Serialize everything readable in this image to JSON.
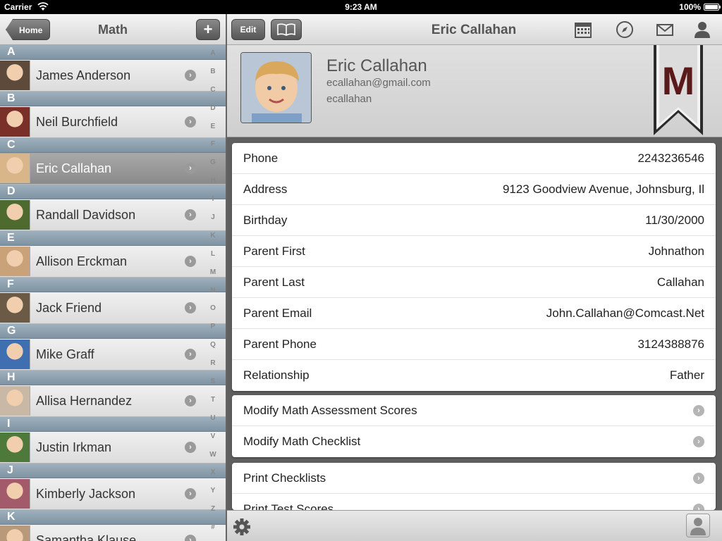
{
  "status_bar": {
    "carrier": "Carrier",
    "time": "9:23 AM",
    "battery": "100%"
  },
  "left": {
    "home_label": "Home",
    "title": "Math",
    "add_label": "+",
    "sections": [
      {
        "letter": "A",
        "name": "James Anderson",
        "color": "#5d4a3a",
        "selected": false
      },
      {
        "letter": "B",
        "name": "Neil Burchfield",
        "color": "#7a3028",
        "selected": false
      },
      {
        "letter": "C",
        "name": "Eric Callahan",
        "color": "#d9b68a",
        "selected": true
      },
      {
        "letter": "D",
        "name": "Randall Davidson",
        "color": "#4e6a2e",
        "selected": false
      },
      {
        "letter": "E",
        "name": "Allison Erckman",
        "color": "#c9a27a",
        "selected": false
      },
      {
        "letter": "F",
        "name": "Jack Friend",
        "color": "#6b5a45",
        "selected": false
      },
      {
        "letter": "G",
        "name": "Mike Graff",
        "color": "#3f6fb0",
        "selected": false
      },
      {
        "letter": "H",
        "name": "Allisa Hernandez",
        "color": "#c8b8a5",
        "selected": false
      },
      {
        "letter": "I",
        "name": "Justin Irkman",
        "color": "#4d7a3a",
        "selected": false
      },
      {
        "letter": "J",
        "name": "Kimberly Jackson",
        "color": "#a35a6a",
        "selected": false
      },
      {
        "letter": "K",
        "name": "Samantha Klause",
        "color": "#b89a7a",
        "selected": false
      }
    ],
    "index_letters": [
      "A",
      "B",
      "C",
      "D",
      "E",
      "F",
      "G",
      "H",
      "I",
      "J",
      "K",
      "L",
      "M",
      "N",
      "O",
      "P",
      "Q",
      "R",
      "S",
      "T",
      "U",
      "V",
      "W",
      "X",
      "Y",
      "Z",
      "#"
    ]
  },
  "right": {
    "edit_label": "Edit",
    "title": "Eric Callahan",
    "profile": {
      "name": "Eric Callahan",
      "email": "ecallahan@gmail.com",
      "username": "ecallahan",
      "ribbon_letter": "M"
    },
    "details": [
      {
        "label": "Phone",
        "value": "2243236546"
      },
      {
        "label": "Address",
        "value": "9123 Goodview Avenue, Johnsburg, Il"
      },
      {
        "label": "Birthday",
        "value": "11/30/2000"
      },
      {
        "label": "Parent First",
        "value": "Johnathon"
      },
      {
        "label": "Parent Last",
        "value": "Callahan"
      },
      {
        "label": "Parent Email",
        "value": "John.Callahan@Comcast.Net"
      },
      {
        "label": "Parent Phone",
        "value": "3124388876"
      },
      {
        "label": "Relationship",
        "value": "Father"
      }
    ],
    "actions": [
      "Modify Math Assessment Scores",
      "Modify Math Checklist"
    ],
    "print_actions": [
      "Print Checklists",
      "Print Test Scores"
    ]
  }
}
